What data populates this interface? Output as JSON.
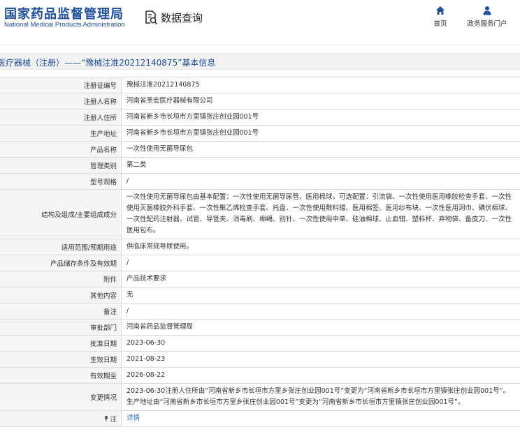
{
  "header": {
    "logo_cn": "国家药品监督管理局",
    "logo_en": "National Medical Products Administration",
    "query_label": "数据查询",
    "nav": [
      {
        "label": "首页",
        "icon": "home-icon"
      },
      {
        "label": "政务服务门户",
        "icon": "user-icon"
      }
    ]
  },
  "page": {
    "title": "医疗器械（注册）——“豫械注准20212140875”基本信息"
  },
  "colors": {
    "brand": "#1d4f9c",
    "link": "#2a6ebd"
  },
  "rows": [
    {
      "label": "注册证编号",
      "value": "豫械注准20212140875"
    },
    {
      "label": "注册人名称",
      "value": "河南省圣宏医疗器械有限公司"
    },
    {
      "label": "注册人住所",
      "value": "河南省新乡市长垣市方里镇张庄创业园001号"
    },
    {
      "label": "生产地址",
      "value": "河南省新乡市长垣市方里镇张庄创业园001号"
    },
    {
      "label": "产品名称",
      "value": "一次性使用无菌导尿包"
    },
    {
      "label": "管理类别",
      "value": "第二类"
    },
    {
      "label": "型号规格",
      "value": "/"
    },
    {
      "label": "结构及组成/主要组成成分",
      "value": "一次性使用无菌导尿包由基本配置：一次性使用无菌导尿管、医用棉球，可选配置：引流袋、一次性使用医用橡胶检查手套、一次性使用灭菌橡胶外科手套、一次性聚乙烯检查手套、托盘、一次性使用敷料镊、医用棉签、医用纱布块、一次性医用洞巾、碘伏棉球、一次性配药注射器、试管、导管夹、消毒刷、棉绳、别针、一次性使用中单、硅油棉球、止血钳、塑料杯、弃物袋、备皮刀、一次性医用包布。"
    },
    {
      "label": "适用范围/预期用途",
      "value": "供临床常规导尿使用。"
    },
    {
      "label": "产品储存条件及有效期",
      "value": "/"
    },
    {
      "label": "附件",
      "value": "产品技术要求"
    },
    {
      "label": "其他内容",
      "value": "无"
    },
    {
      "label": "备注",
      "value": "/"
    },
    {
      "label": "审批部门",
      "value": "河南省药品监督管理局"
    },
    {
      "label": "批准日期",
      "value": "2023-06-30"
    },
    {
      "label": "生效日期",
      "value": "2021-08-23"
    },
    {
      "label": "有效期至",
      "value": "2026-08-22"
    },
    {
      "label": "变更情况",
      "value": "2023-06-30注册人住所由“河南省新乡市长垣市方里乡张庄创业园001号”变更为“河南省新乡市长垣市方里镇张庄创业园001号”。生产地址由“河南省新乡市长垣市方里乡张庄创业园001号”变更为“河南省新乡市长垣市方里镇张庄创业园001号”。"
    }
  ],
  "note": {
    "label": "注",
    "value": "详情"
  }
}
